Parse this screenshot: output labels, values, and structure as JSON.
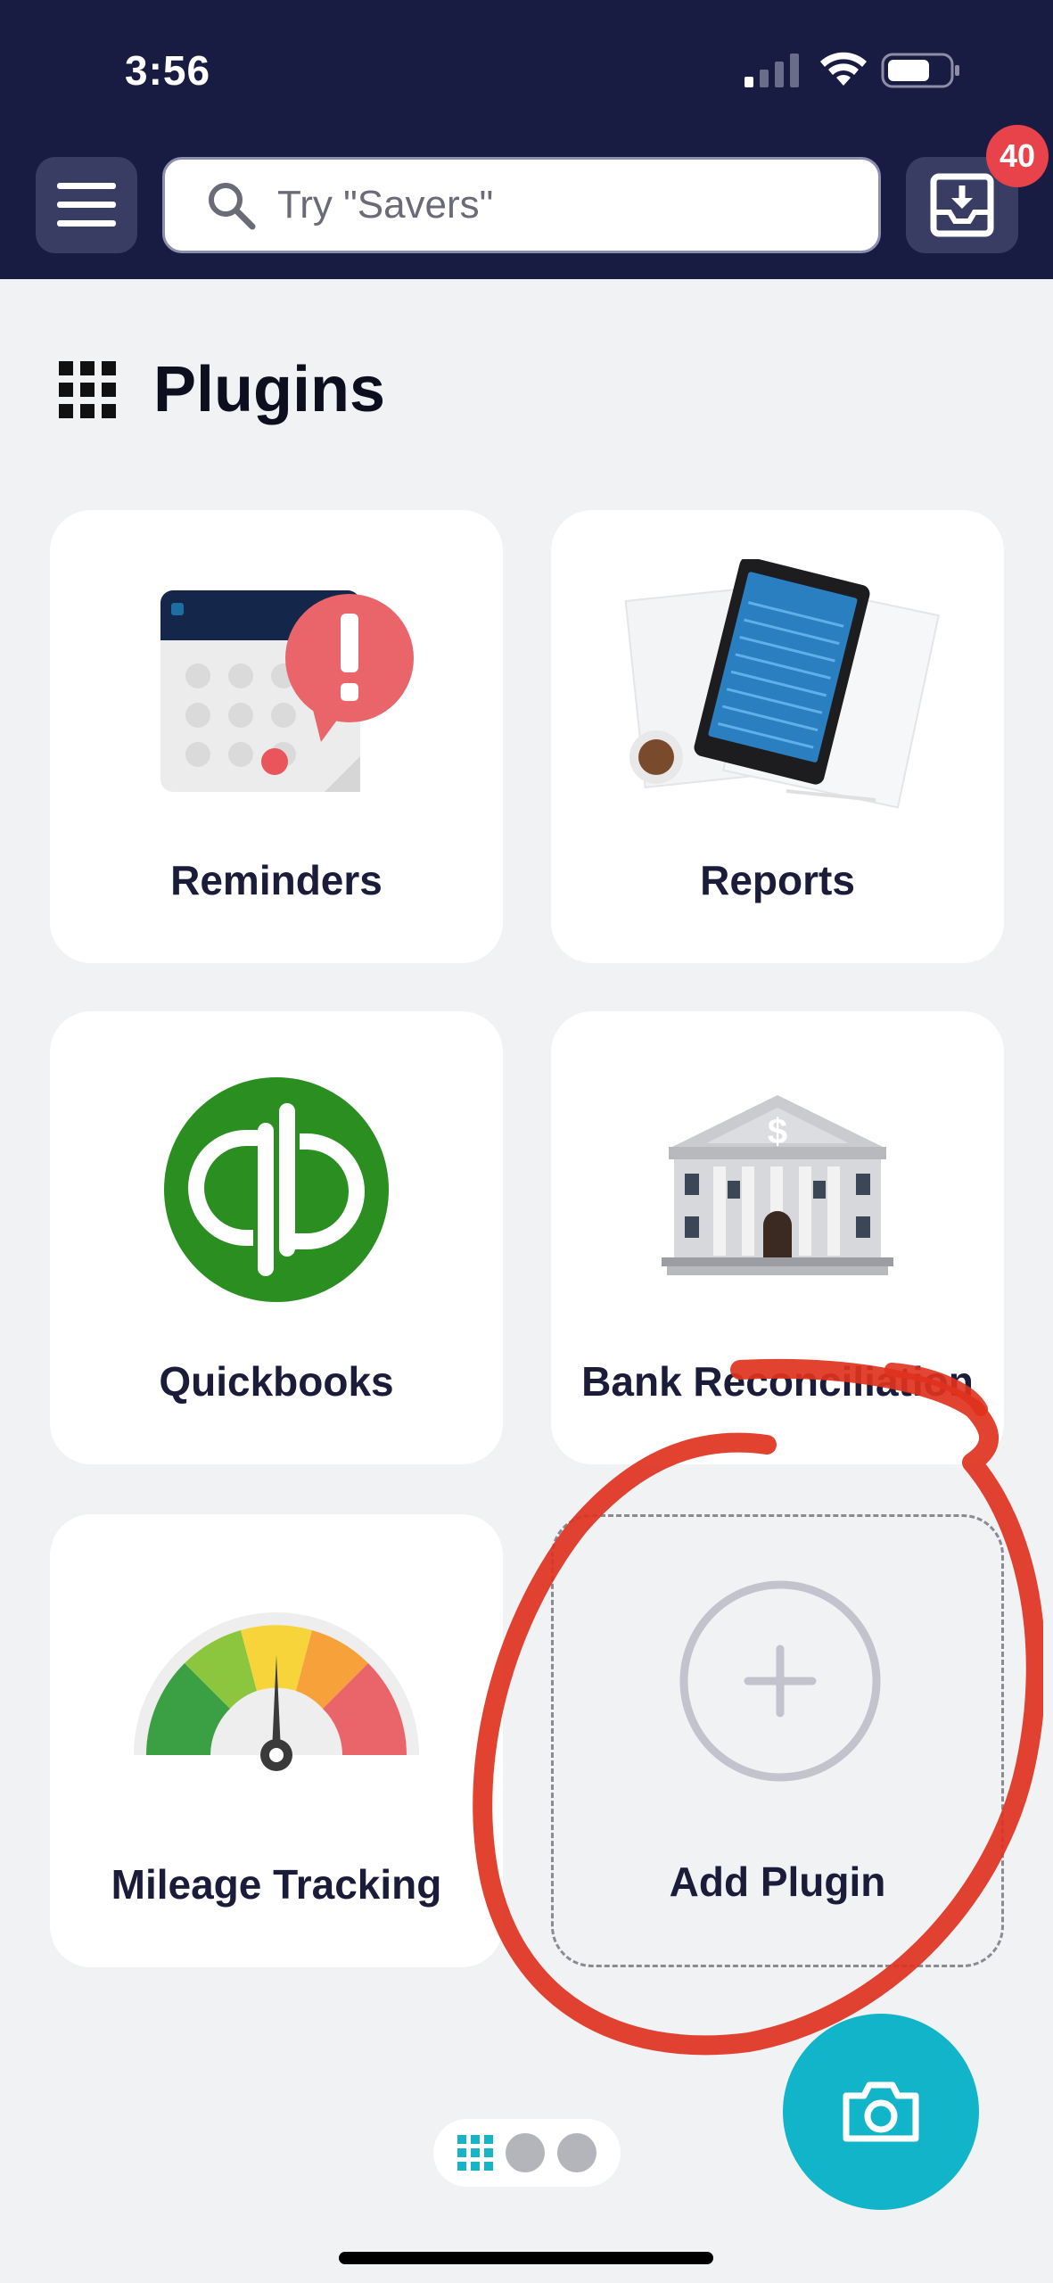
{
  "status_bar": {
    "time": "3:56"
  },
  "header": {
    "search_placeholder": "Try \"Savers\"",
    "inbox_badge": "40"
  },
  "section": {
    "title": "Plugins"
  },
  "plugins": [
    {
      "label": "Reminders",
      "icon": "calendar-alert-icon"
    },
    {
      "label": "Reports",
      "icon": "tablet-report-icon"
    },
    {
      "label": "Quickbooks",
      "icon": "quickbooks-logo",
      "logo_text": "qb",
      "logo_color": "#2ca01c"
    },
    {
      "label": "Bank Reconciliation",
      "icon": "bank-building-icon"
    },
    {
      "label": "Mileage Tracking",
      "icon": "speedometer-icon"
    }
  ],
  "add_plugin": {
    "label": "Add Plugin",
    "icon": "plus-circle-icon"
  },
  "pager": {
    "icons": [
      "grid-icon",
      "dot",
      "dot"
    ]
  },
  "fab": {
    "icon": "camera-icon",
    "color": "#12b4c9"
  },
  "colors": {
    "header_bg": "#191c42",
    "badge": "#e8424a",
    "annotation": "#e0321e"
  }
}
